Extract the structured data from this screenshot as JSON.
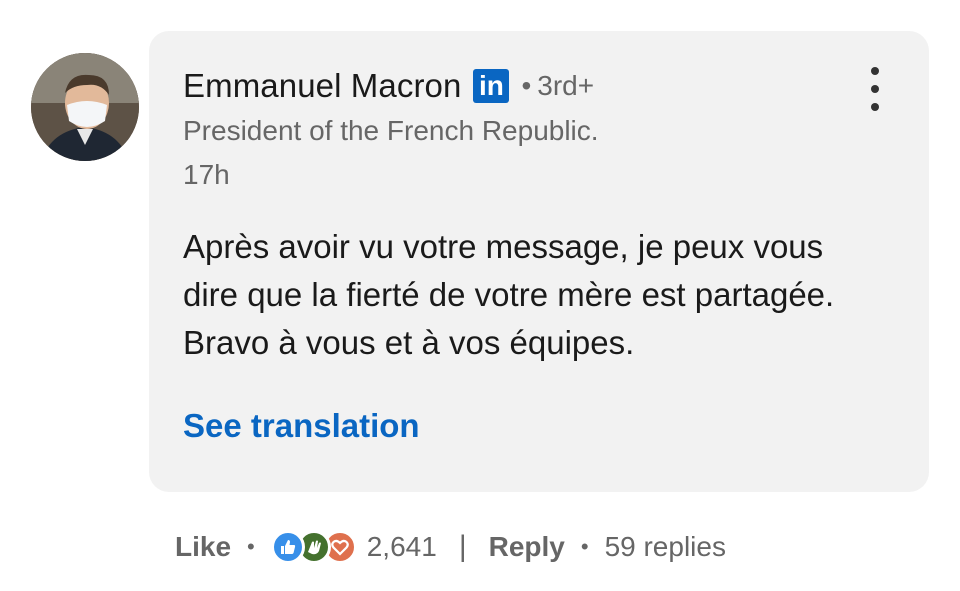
{
  "comment": {
    "author": {
      "name": "Emmanuel Macron",
      "badge_text": "in",
      "degree_separator": "•",
      "degree": "3rd+",
      "headline": "President of the French Republic.",
      "timestamp": "17h"
    },
    "body": "Après avoir vu votre message, je peux vous dire que la fierté de votre mère est partagée. Bravo à vous et à vos équipes.",
    "see_translation": "See translation"
  },
  "actions": {
    "like_label": "Like",
    "separator": "•",
    "reactions": [
      "like-icon",
      "celebrate-icon",
      "love-icon"
    ],
    "reaction_count": "2,641",
    "pipe": "|",
    "reply_label": "Reply",
    "replies_text": "59 replies"
  },
  "colors": {
    "link_blue": "#0a66c2",
    "bubble_bg": "#f2f2f2",
    "like_blue": "#378fe9",
    "celebrate_green": "#44712e",
    "love_orange": "#df704d"
  }
}
